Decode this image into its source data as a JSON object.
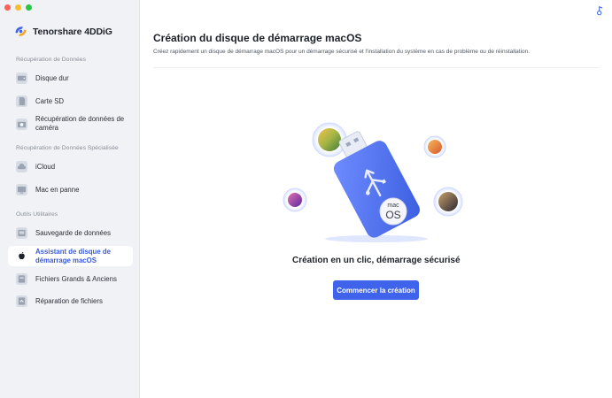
{
  "window": {
    "brand_name": "Tenorshare 4DDiG"
  },
  "sidebar": {
    "sections": [
      {
        "title": "Récupération de Données"
      },
      {
        "title": "Récupération de Données Spécialisée"
      },
      {
        "title": "Outils Utilitaires"
      }
    ],
    "items": [
      {
        "label": "Disque dur",
        "icon": "hard-drive-icon"
      },
      {
        "label": "Carte SD",
        "icon": "sd-card-icon"
      },
      {
        "label": "Récupération de données de caméra",
        "icon": "camera-icon"
      },
      {
        "label": "iCloud",
        "icon": "cloud-icon"
      },
      {
        "label": "Mac en panne",
        "icon": "crashed-mac-icon"
      },
      {
        "label": "Sauvegarde de données",
        "icon": "backup-icon"
      },
      {
        "label": "Assistant de disque de démarrage macOS",
        "icon": "apple-icon",
        "active": true
      },
      {
        "label": "Fichiers Grands & Anciens",
        "icon": "files-icon"
      },
      {
        "label": "Réparation de fichiers",
        "icon": "file-repair-icon"
      }
    ]
  },
  "main": {
    "title": "Création du disque de démarrage macOS",
    "subtitle": "Créez rapidement un disque de démarrage macOS pour un démarrage sécurisé et l'installation du système en cas de problème ou de réinstallation.",
    "illustration": {
      "badge_top": "mac",
      "badge_bottom": "OS"
    },
    "hero_title": "Création en un clic, démarrage sécurisé",
    "cta_label": "Commencer la création"
  },
  "colors": {
    "accent": "#3f63ea",
    "active_text": "#3a5ad9",
    "sidebar_bg": "#f1f2f6"
  }
}
